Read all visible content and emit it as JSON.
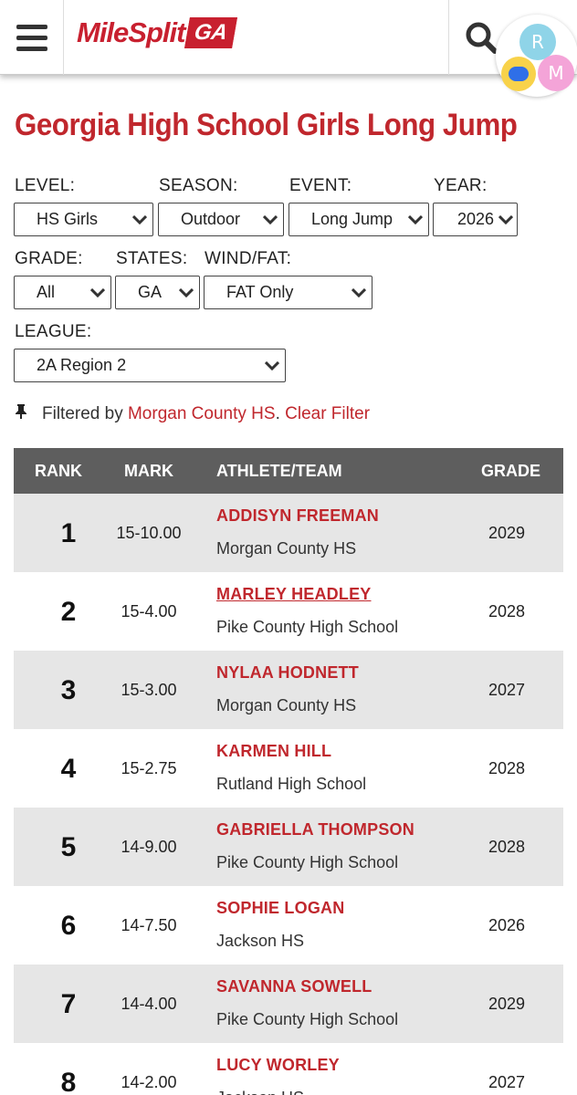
{
  "header": {
    "logo_word": "MileSplit",
    "logo_state": "GA",
    "avatar_r": "R",
    "avatar_m": "M"
  },
  "page": {
    "title": "Georgia High School Girls Long Jump"
  },
  "filters": {
    "level": {
      "label": "LEVEL:",
      "value": "HS Girls"
    },
    "season": {
      "label": "SEASON:",
      "value": "Outdoor"
    },
    "event": {
      "label": "EVENT:",
      "value": "Long Jump"
    },
    "year": {
      "label": "YEAR:",
      "value": "2026"
    },
    "grade": {
      "label": "GRADE:",
      "value": "All"
    },
    "states": {
      "label": "STATES:",
      "value": "GA"
    },
    "wind": {
      "label": "WIND/FAT:",
      "value": "FAT Only"
    },
    "league": {
      "label": "LEAGUE:",
      "value": "2A Region 2"
    }
  },
  "filter_notice": {
    "prefix": "Filtered by",
    "team": "Morgan County HS",
    "clear": "Clear Filter"
  },
  "table": {
    "headers": {
      "rank": "RANK",
      "mark": "MARK",
      "athlete": "ATHLETE/TEAM",
      "grade": "GRADE"
    },
    "rows": [
      {
        "rank": "1",
        "mark": "15-10.00",
        "athlete": "ADDISYN FREEMAN",
        "team": "Morgan County HS",
        "grade": "2029"
      },
      {
        "rank": "2",
        "mark": "15-4.00",
        "athlete": "MARLEY HEADLEY",
        "team": "Pike County High School",
        "grade": "2028"
      },
      {
        "rank": "3",
        "mark": "15-3.00",
        "athlete": "NYLAA HODNETT",
        "team": "Morgan County HS",
        "grade": "2027"
      },
      {
        "rank": "4",
        "mark": "15-2.75",
        "athlete": "KARMEN HILL",
        "team": "Rutland High School",
        "grade": "2028"
      },
      {
        "rank": "5",
        "mark": "14-9.00",
        "athlete": "GABRIELLA THOMPSON",
        "team": "Pike County High School",
        "grade": "2028"
      },
      {
        "rank": "6",
        "mark": "14-7.50",
        "athlete": "SOPHIE LOGAN",
        "team": "Jackson HS",
        "grade": "2026"
      },
      {
        "rank": "7",
        "mark": "14-4.00",
        "athlete": "SAVANNA SOWELL",
        "team": "Pike County High School",
        "grade": "2029"
      },
      {
        "rank": "8",
        "mark": "14-2.00",
        "athlete": "LUCY WORLEY",
        "team": "Jackson HS",
        "grade": "2027"
      }
    ]
  }
}
